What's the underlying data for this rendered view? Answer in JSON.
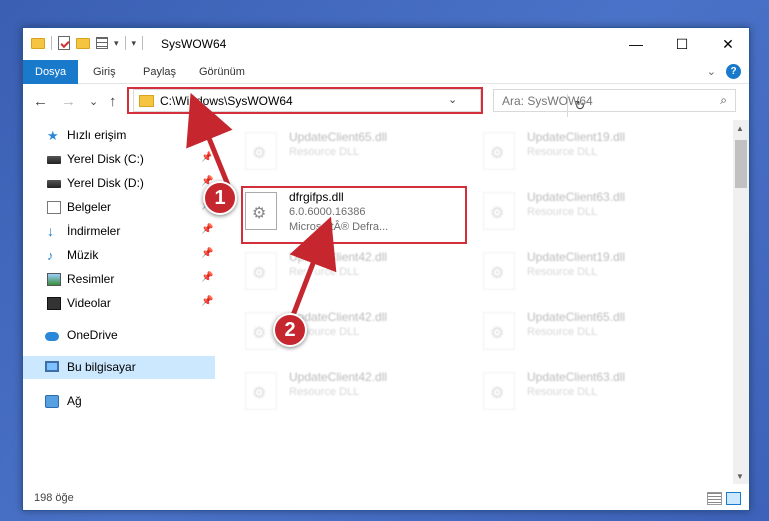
{
  "window": {
    "title": "SysWOW64",
    "controls": {
      "minimize": "—",
      "maximize": "☐",
      "close": "✕"
    }
  },
  "ribbon": {
    "tabs": [
      {
        "label": "Dosya",
        "active": true
      },
      {
        "label": "Giriş"
      },
      {
        "label": "Paylaş"
      },
      {
        "label": "Görünüm"
      }
    ],
    "expand": "⌄",
    "help": "?"
  },
  "nav": {
    "back": "←",
    "forward": "→",
    "recent": "⌄",
    "up": "↑",
    "address": "C:\\Windows\\SysWOW64",
    "address_drop": "⌄",
    "refresh": "↻",
    "search_placeholder": "Ara: SysWOW64",
    "search_icon": "⌕"
  },
  "sidebar": {
    "items": [
      {
        "label": "Hızlı erişim",
        "icon": "star-icon"
      },
      {
        "label": "Yerel Disk (C:)",
        "icon": "disk-icon",
        "pin": "📌"
      },
      {
        "label": "Yerel Disk (D:)",
        "icon": "disk-icon",
        "pin": "📌"
      },
      {
        "label": "Belgeler",
        "icon": "documents-icon",
        "pin": "📌"
      },
      {
        "label": "İndirmeler",
        "icon": "downloads-icon",
        "pin": "📌"
      },
      {
        "label": "Müzik",
        "icon": "music-icon",
        "pin": "📌"
      },
      {
        "label": "Resimler",
        "icon": "pictures-icon",
        "pin": "📌"
      },
      {
        "label": "Videolar",
        "icon": "videos-icon",
        "pin": "📌"
      },
      {
        "label": "OneDrive",
        "icon": "onedrive-icon"
      },
      {
        "label": "Bu bilgisayar",
        "icon": "this-pc-icon",
        "selected": true
      },
      {
        "label": "Ağ",
        "icon": "network-icon"
      }
    ]
  },
  "files": {
    "col1": [
      {
        "name": "UpdateClient65.dll",
        "type": "Resource DLL"
      },
      {
        "name": "dfrgifps.dll",
        "version": "6.0.6000.16386",
        "company": "MicrosoftÂ® Defra..."
      },
      {
        "name": "UpdateClient42.dll",
        "type": "Resource DLL"
      },
      {
        "name": "UpdateClient42.dll",
        "type": "Resource DLL"
      },
      {
        "name": "UpdateClient42.dll",
        "type": "Resource DLL"
      }
    ],
    "col2": [
      {
        "name": "UpdateClient19.dll",
        "type": "Resource DLL"
      },
      {
        "name": "UpdateClient63.dll",
        "type": "Resource DLL"
      },
      {
        "name": "UpdateClient19.dll",
        "type": "Resource DLL"
      },
      {
        "name": "UpdateClient65.dll",
        "type": "Resource DLL"
      },
      {
        "name": "UpdateClient63.dll",
        "type": "Resource DLL"
      }
    ]
  },
  "status": {
    "count": "198 öğe"
  },
  "callouts": {
    "step1": "1",
    "step2": "2"
  },
  "colors": {
    "accent": "#1979ca",
    "highlight": "#d32f3b",
    "badge": "#c6262e"
  }
}
